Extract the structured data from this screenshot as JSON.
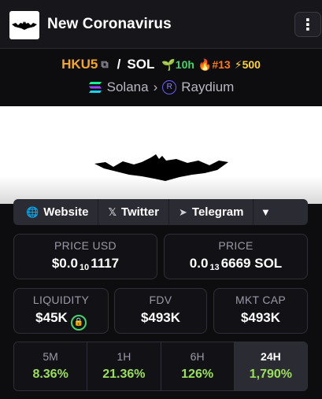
{
  "header": {
    "title": "New Coronavirus",
    "menu_icon": "kebab-menu-icon",
    "logo": "bat-logo"
  },
  "pair": {
    "base": "HKU5",
    "separator": "/",
    "quote": "SOL",
    "age": "10h",
    "rank": "#13",
    "boosts": "500",
    "colors": {
      "base": "#f6a623",
      "age": "#46d26c",
      "rank": "#ff7a1a",
      "boosts": "#ffd43a"
    }
  },
  "chain": {
    "name": "Solana",
    "dex": "Raydium"
  },
  "links": {
    "website": "Website",
    "twitter": "Twitter",
    "telegram": "Telegram"
  },
  "stats": {
    "price_usd_label": "PRICE USD",
    "price_usd_prefix": "$0.0",
    "price_usd_zeros": "10",
    "price_usd_digits": "1117",
    "price_label": "PRICE",
    "price_prefix": "0.0",
    "price_zeros": "13",
    "price_digits": "6669 SOL",
    "liquidity_label": "LIQUIDITY",
    "liquidity": "$45K",
    "fdv_label": "FDV",
    "fdv": "$493K",
    "mcap_label": "MKT CAP",
    "mcap": "$493K"
  },
  "changes": [
    {
      "period": "5M",
      "change": "8.36%"
    },
    {
      "period": "1H",
      "change": "21.36%"
    },
    {
      "period": "6H",
      "change": "126%"
    },
    {
      "period": "24H",
      "change": "1,790%"
    }
  ]
}
